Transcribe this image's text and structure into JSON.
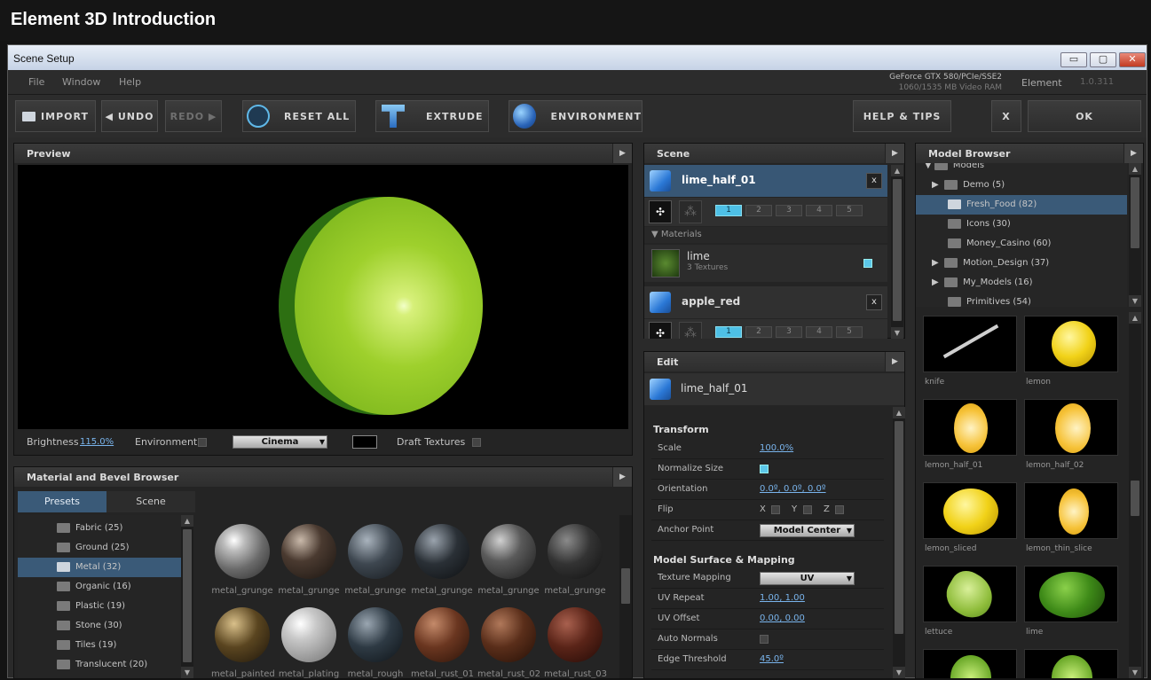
{
  "video_title": "Element 3D Introduction",
  "window": {
    "title": "Scene Setup",
    "min": "▭",
    "max": "▢",
    "close": "✕"
  },
  "menu": [
    "File",
    "Window",
    "Help"
  ],
  "gpu": {
    "line1": "GeForce GTX 580/PCIe/SSE2",
    "line2": "1060/1535 MB Video RAM"
  },
  "app": {
    "name": "Element",
    "version": "1.0.311"
  },
  "toolbar": {
    "import": "IMPORT",
    "undo": "UNDO",
    "redo": "REDO",
    "reset_all": "RESET ALL",
    "extrude": "EXTRUDE",
    "environment": "ENVIRONMENT",
    "help_tips": "HELP & TIPS",
    "x": "X",
    "ok": "OK"
  },
  "preview": {
    "title": "Preview",
    "brightness_label": "Brightness",
    "brightness_value": "115.0%",
    "environment_label": "Environment",
    "env_dropdown": "Cinema",
    "draft_textures_label": "Draft Textures"
  },
  "material_browser": {
    "title": "Material and Bevel Browser",
    "tabs": [
      "Presets",
      "Scene"
    ],
    "categories": [
      {
        "label": "Fabric (25)"
      },
      {
        "label": "Ground (25)"
      },
      {
        "label": "Metal (32)",
        "selected": true
      },
      {
        "label": "Organic (16)"
      },
      {
        "label": "Plastic (19)"
      },
      {
        "label": "Stone (30)"
      },
      {
        "label": "Tiles (19)"
      },
      {
        "label": "Translucent (20)"
      }
    ],
    "materials_row1": [
      "metal_grunge",
      "metal_grunge",
      "metal_grunge",
      "metal_grunge",
      "metal_grunge",
      "metal_grunge"
    ],
    "materials_row2": [
      "metal_painted",
      "metal_plating",
      "metal_rough",
      "metal_rust_01",
      "metal_rust_02",
      "metal_rust_03"
    ]
  },
  "scene": {
    "title": "Scene",
    "obj1": "lime_half_01",
    "obj1_x": "x",
    "groups": [
      "1",
      "2",
      "3",
      "4",
      "5"
    ],
    "materials_header": "Materials",
    "material_name": "lime",
    "material_sub": "3 Textures",
    "obj2": "apple_red",
    "obj2_x": "x"
  },
  "edit": {
    "title": "Edit",
    "object": "lime_half_01",
    "transform_header": "Transform",
    "scale_label": "Scale",
    "scale_value": "100.0%",
    "normalize_label": "Normalize Size",
    "orientation_label": "Orientation",
    "orientation_value": "0.0º, 0.0º, 0.0º",
    "flip_label": "Flip",
    "flip_x": "X",
    "flip_y": "Y",
    "flip_z": "Z",
    "anchor_label": "Anchor Point",
    "anchor_value": "Model Center",
    "surface_header": "Model Surface & Mapping",
    "texmap_label": "Texture Mapping",
    "texmap_value": "UV",
    "uvrepeat_label": "UV Repeat",
    "uvrepeat_value": "1.00, 1.00",
    "uvoffset_label": "UV Offset",
    "uvoffset_value": "0.00, 0.00",
    "autonormals_label": "Auto Normals",
    "edge_label": "Edge Threshold",
    "edge_value": "45.0º"
  },
  "model_browser": {
    "title": "Model Browser",
    "root": "Models",
    "tree": [
      {
        "label": "Demo (5)",
        "expandable": true
      },
      {
        "label": "Fresh_Food (82)",
        "selected": true
      },
      {
        "label": "Icons (30)"
      },
      {
        "label": "Money_Casino (60)"
      },
      {
        "label": "Motion_Design (37)",
        "expandable": true
      },
      {
        "label": "My_Models (16)",
        "expandable": true
      },
      {
        "label": "Primitives (54)"
      }
    ],
    "models": [
      "knife",
      "lemon",
      "lemon_half_01",
      "lemon_half_02",
      "lemon_sliced",
      "lemon_thin_slice",
      "lettuce",
      "lime"
    ]
  },
  "colors": {
    "accent": "#5cc7e8",
    "selected": "#3a5a78",
    "link": "#79b4ec"
  }
}
